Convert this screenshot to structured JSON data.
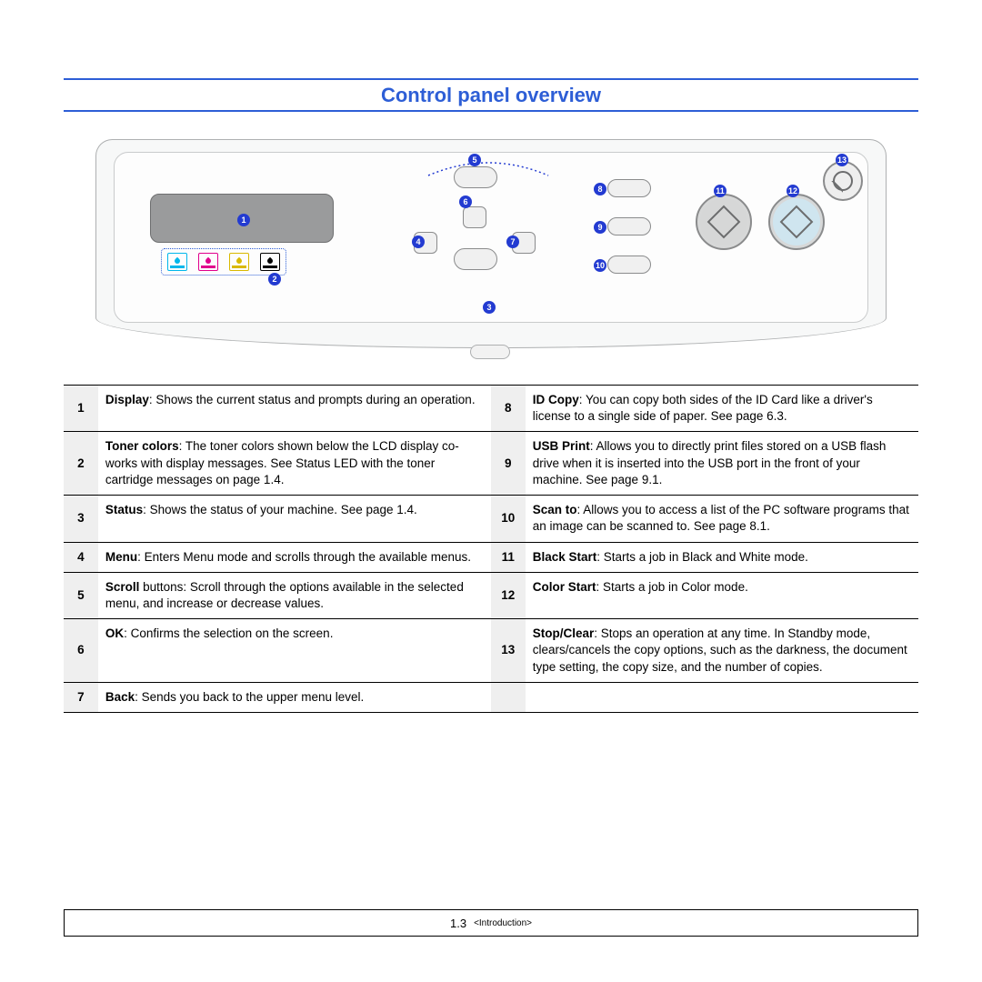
{
  "title": "Control panel overview",
  "callouts": [
    "1",
    "2",
    "3",
    "4",
    "5",
    "6",
    "7",
    "8",
    "9",
    "10",
    "11",
    "12",
    "13"
  ],
  "rows": [
    {
      "n": "1",
      "bold": "Display",
      "text": ": Shows the current status and prompts during an operation."
    },
    {
      "n": "2",
      "bold": "Toner colors",
      "text": ": The toner colors shown below the LCD display co-works with display messages.  See Status LED with the toner cartridge messages on page 1.4."
    },
    {
      "n": "3",
      "bold": "Status",
      "text": ": Shows the status of your machine. See page 1.4."
    },
    {
      "n": "4",
      "bold": "Menu",
      "text": ": Enters Menu mode and scrolls through the available menus."
    },
    {
      "n": "5",
      "bold": "Scroll",
      "text": " buttons: Scroll through the options available in the selected menu, and increase or decrease values."
    },
    {
      "n": "6",
      "bold": "OK",
      "text": ": Confirms the selection on the screen."
    },
    {
      "n": "7",
      "bold": "Back",
      "text": ": Sends you back to the upper menu level."
    },
    {
      "n": "8",
      "bold": "ID Copy",
      "text": ": You can copy both sides of the ID Card like a driver's license to a single side of paper. See page 6.3."
    },
    {
      "n": "9",
      "bold": "USB Print",
      "text": ": Allows you to directly print files stored on a USB flash drive when it is inserted into the USB port in the front of your machine. See page 9.1."
    },
    {
      "n": "10",
      "bold": "Scan to",
      "text": ": Allows you to access a list of the PC software programs that an image can be scanned to. See page 8.1."
    },
    {
      "n": "11",
      "bold": "Black Start",
      "text": ": Starts a job in Black and White mode."
    },
    {
      "n": "12",
      "bold": "Color Start",
      "text": ": Starts a job in Color mode."
    },
    {
      "n": "13",
      "bold": "Stop/Clear",
      "text": ": Stops an operation at any time. In Standby mode, clears/cancels the copy options, such as the darkness, the document type setting, the copy size, and the number of copies."
    }
  ],
  "footer": {
    "page": "1.3",
    "section": "<Introduction>"
  }
}
